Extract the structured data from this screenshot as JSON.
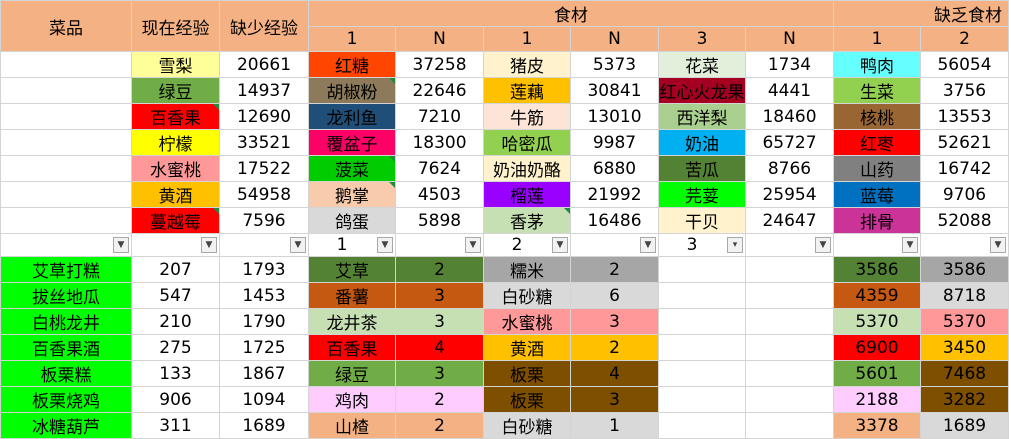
{
  "headers": {
    "dish": "菜品",
    "cur_exp": "现在经验",
    "lack_exp": "缺少经验",
    "ingredients": "食材",
    "lacking": "缺乏食材",
    "sub": [
      "1",
      "N",
      "1",
      "N",
      "3",
      "N",
      "1",
      "2"
    ]
  },
  "top_rows": [
    {
      "a": "雪梨",
      "b": "20661",
      "c": "红糖",
      "d": "37258",
      "e": "猪皮",
      "f": "5373",
      "g": "花菜",
      "h": "1734",
      "i": "鸭肉",
      "j": "56054"
    },
    {
      "a": "绿豆",
      "b": "14937",
      "c": "胡椒粉",
      "d": "22646",
      "e": "莲藕",
      "f": "30841",
      "g": "红心火龙果",
      "h": "4441",
      "i": "生菜",
      "j": "3756"
    },
    {
      "a": "百香果",
      "b": "12690",
      "c": "龙利鱼",
      "d": "7210",
      "e": "牛筋",
      "f": "13010",
      "g": "西洋梨",
      "h": "18460",
      "i": "核桃",
      "j": "13553"
    },
    {
      "a": "柠檬",
      "b": "33521",
      "c": "覆盆子",
      "d": "18300",
      "e": "哈密瓜",
      "f": "9987",
      "g": "奶油",
      "h": "65727",
      "i": "红枣",
      "j": "52621"
    },
    {
      "a": "水蜜桃",
      "b": "17522",
      "c": "菠菜",
      "d": "7624",
      "e": "奶油奶酪",
      "f": "6880",
      "g": "苦瓜",
      "h": "8766",
      "i": "山药",
      "j": "16742"
    },
    {
      "a": "黄酒",
      "b": "54958",
      "c": "鹅掌",
      "d": "4503",
      "e": "榴莲",
      "f": "21992",
      "g": "芫荽",
      "h": "25954",
      "i": "蓝莓",
      "j": "9706"
    },
    {
      "a": "蔓越莓",
      "b": "7596",
      "c": "鸽蛋",
      "d": "5898",
      "e": "香茅",
      "f": "16486",
      "g": "干贝",
      "h": "24647",
      "i": "排骨",
      "j": "52088"
    }
  ],
  "filter": {
    "c": "1",
    "e": "2",
    "g": "3"
  },
  "bottom_rows": [
    {
      "dish": "艾草打糕",
      "cur": "207",
      "lack": "1793",
      "i1": "艾草",
      "n1": "2",
      "i2": "糯米",
      "n2": "2",
      "l1": "3586",
      "l2": "3586"
    },
    {
      "dish": "拔丝地瓜",
      "cur": "547",
      "lack": "1453",
      "i1": "番薯",
      "n1": "3",
      "i2": "白砂糖",
      "n2": "6",
      "l1": "4359",
      "l2": "8718"
    },
    {
      "dish": "白桃龙井",
      "cur": "210",
      "lack": "1790",
      "i1": "龙井茶",
      "n1": "3",
      "i2": "水蜜桃",
      "n2": "3",
      "l1": "5370",
      "l2": "5370"
    },
    {
      "dish": "百香果酒",
      "cur": "275",
      "lack": "1725",
      "i1": "百香果",
      "n1": "4",
      "i2": "黄酒",
      "n2": "2",
      "l1": "6900",
      "l2": "3450"
    },
    {
      "dish": "板栗糕",
      "cur": "133",
      "lack": "1867",
      "i1": "绿豆",
      "n1": "3",
      "i2": "板栗",
      "n2": "4",
      "l1": "5601",
      "l2": "7468"
    },
    {
      "dish": "板栗烧鸡",
      "cur": "906",
      "lack": "1094",
      "i1": "鸡肉",
      "n1": "2",
      "i2": "板栗",
      "n2": "3",
      "l1": "2188",
      "l2": "3282"
    },
    {
      "dish": "冰糖葫芦",
      "cur": "311",
      "lack": "1689",
      "i1": "山楂",
      "n1": "2",
      "i2": "白砂糖",
      "n2": "1",
      "l1": "3378",
      "l2": "1689"
    }
  ],
  "colors": {
    "header": "#f4b183",
    "dish_green": "#00ff00",
    "flag_green": "#1e8c3c"
  }
}
